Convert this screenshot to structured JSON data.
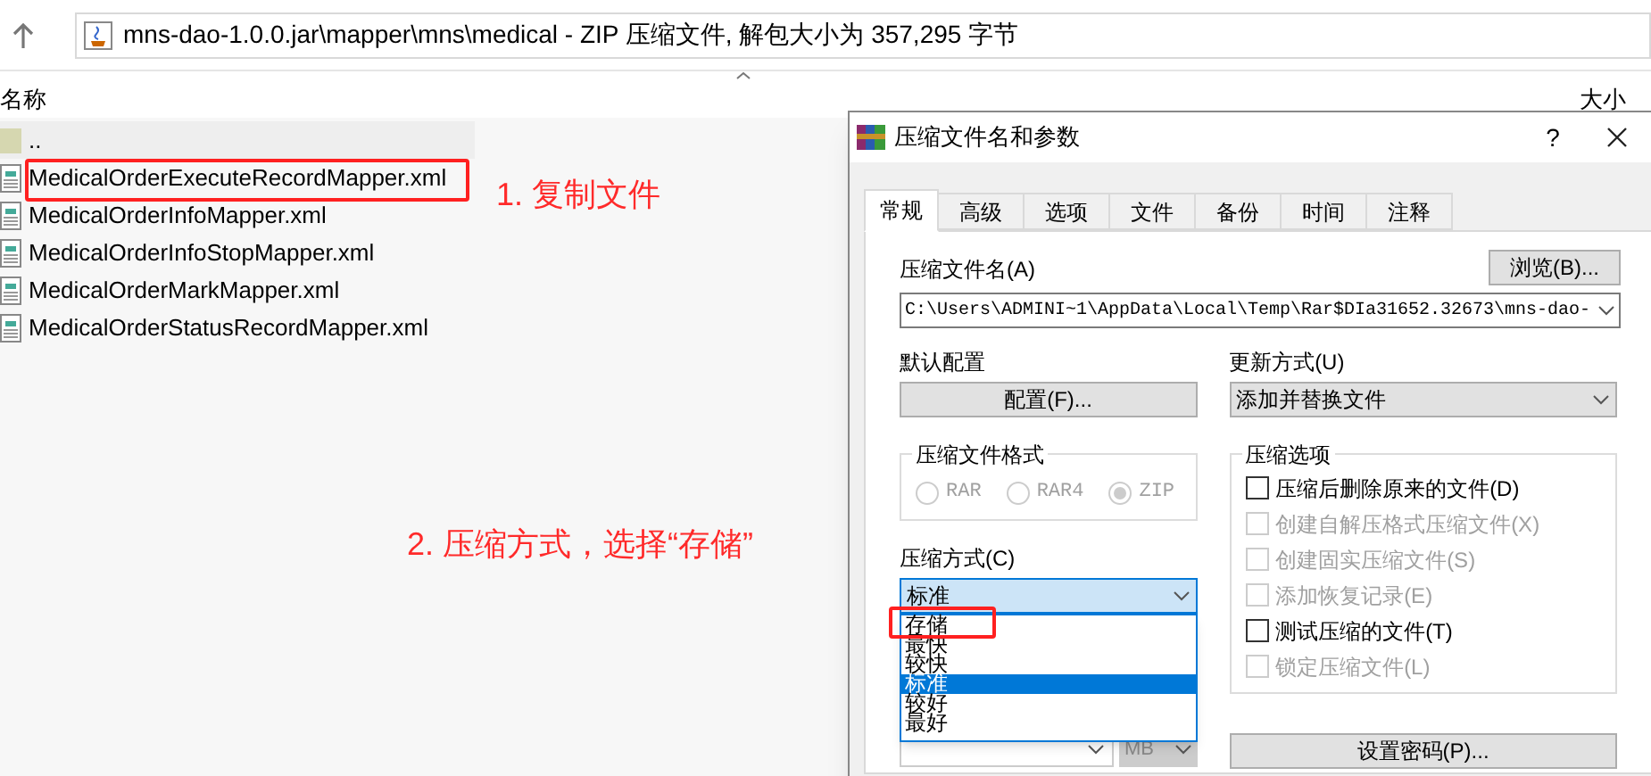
{
  "explorer": {
    "address": "mns-dao-1.0.0.jar\\mapper\\mns\\medical - ZIP 压缩文件, 解包大小为 357,295 字节",
    "columns": [
      "名称",
      "大小"
    ],
    "files": [
      {
        "kind": "folder",
        "name": "..",
        "highlighted": false
      },
      {
        "kind": "xml",
        "name": "MedicalOrderExecuteRecordMapper.xml",
        "highlighted": true
      },
      {
        "kind": "xml",
        "name": "MedicalOrderInfoMapper.xml",
        "highlighted": false
      },
      {
        "kind": "xml",
        "name": "MedicalOrderInfoStopMapper.xml",
        "highlighted": false
      },
      {
        "kind": "xml",
        "name": "MedicalOrderMarkMapper.xml",
        "highlighted": false
      },
      {
        "kind": "xml",
        "name": "MedicalOrderStatusRecordMapper.xml",
        "highlighted": false
      }
    ]
  },
  "annotations": [
    "1. 复制文件",
    "2. 压缩方式，选择“存储”"
  ],
  "dialog": {
    "title": "压缩文件名和参数",
    "help": "?",
    "tabs": [
      {
        "label": "常规",
        "selected": true
      },
      {
        "label": "高级",
        "selected": false
      },
      {
        "label": "选项",
        "selected": false
      },
      {
        "label": "文件",
        "selected": false
      },
      {
        "label": "备份",
        "selected": false
      },
      {
        "label": "时间",
        "selected": false
      },
      {
        "label": "注释",
        "selected": false
      }
    ],
    "archive_name": {
      "label": "压缩文件名(A)",
      "value": "C:\\Users\\ADMINI~1\\AppData\\Local\\Temp\\Rar$DIa31652.32673\\mns-dao-"
    },
    "browse_button": "浏览(B)...",
    "profile": {
      "label": "默认配置",
      "button": "配置(F)..."
    },
    "update_mode": {
      "label": "更新方式(U)",
      "value": "添加并替换文件"
    },
    "format": {
      "label": "压缩文件格式",
      "options": [
        {
          "label": "RAR",
          "selected": false
        },
        {
          "label": "RAR4",
          "selected": false
        },
        {
          "label": "ZIP",
          "selected": true
        }
      ]
    },
    "method": {
      "label": "压缩方式(C)",
      "value": "标准",
      "expanded": true,
      "options": [
        {
          "label": "存储",
          "selected": false,
          "highlighted": true
        },
        {
          "label": "最快",
          "selected": false,
          "highlighted": false
        },
        {
          "label": "较快",
          "selected": false,
          "highlighted": false
        },
        {
          "label": "标准",
          "selected": true,
          "highlighted": false
        },
        {
          "label": "较好",
          "selected": false,
          "highlighted": false
        },
        {
          "label": "最好",
          "selected": false,
          "highlighted": false
        }
      ]
    },
    "dictionary_unit": "MB",
    "options": {
      "label": "压缩选项",
      "items": [
        {
          "label": "压缩后删除原来的文件(D)",
          "checked": false,
          "disabled": false
        },
        {
          "label": "创建自解压格式压缩文件(X)",
          "checked": false,
          "disabled": true
        },
        {
          "label": "创建固实压缩文件(S)",
          "checked": false,
          "disabled": true
        },
        {
          "label": "添加恢复记录(E)",
          "checked": false,
          "disabled": true
        },
        {
          "label": "测试压缩的文件(T)",
          "checked": false,
          "disabled": false
        },
        {
          "label": "锁定压缩文件(L)",
          "checked": false,
          "disabled": true
        }
      ]
    },
    "password_button": "设置密码(P)..."
  }
}
